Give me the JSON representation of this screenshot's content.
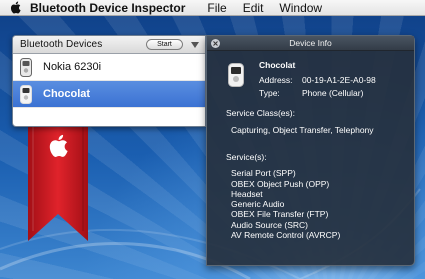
{
  "menubar": {
    "app_name": "Bluetooth Device Inspector",
    "items": [
      "File",
      "Edit",
      "Window"
    ]
  },
  "devices_panel": {
    "title": "Bluetooth Devices",
    "start_label": "Start",
    "devices": [
      {
        "name": "Nokia 6230i",
        "selected": false
      },
      {
        "name": "Chocolat",
        "selected": true
      }
    ]
  },
  "info_panel": {
    "title": "Device Info",
    "device_name": "Chocolat",
    "address_label": "Address:",
    "address_value": "00-19-A1-2E-A0-98",
    "type_label": "Type:",
    "type_value": "Phone (Cellular)",
    "service_class_heading": "Service Class(es):",
    "service_class_value": "Capturing, Object Transfer, Telephony",
    "services_heading": "Service(s):",
    "services": [
      "Serial Port (SPP)",
      "OBEX Object Push (OPP)",
      "Headset",
      "Generic Audio",
      "OBEX File Transfer (FTP)",
      "Audio Source (SRC)",
      "AV Remote Control (AVRCP)"
    ]
  },
  "colors": {
    "selection": "#3b72d3",
    "hud_background": "#26303e",
    "ribbon": "#d11a22",
    "desktop": "#1a5eb0"
  },
  "icons": {
    "menu_logo": "apple-logo-icon",
    "device": "cell-phone-icon",
    "ribbon_badge": "apple-logo-icon",
    "hud_close": "close-icon",
    "drawer_toggle": "disclosure-triangle-icon"
  }
}
